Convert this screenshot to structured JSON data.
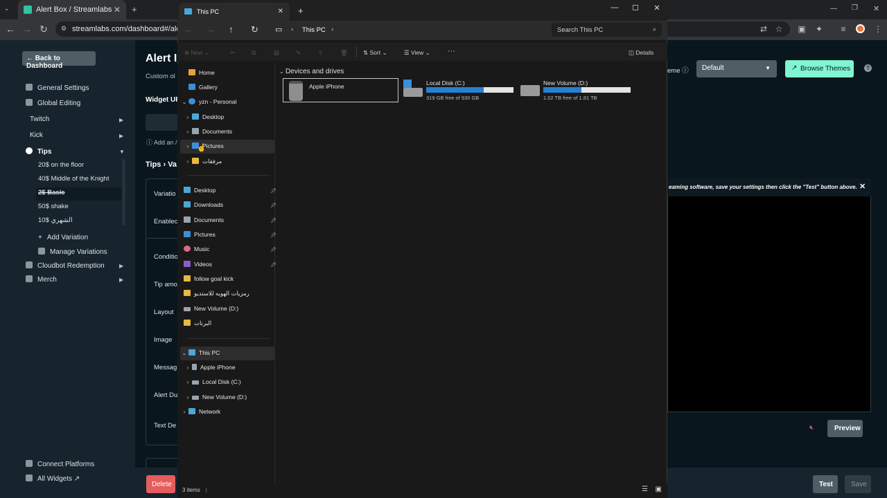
{
  "browser": {
    "tab_title": "Alert Box / Streamlabs",
    "url": "streamlabs.com/dashboard#/alertbc"
  },
  "streamlabs": {
    "back_button": "Back to Dashboard",
    "page_title": "Alert I",
    "page_subtitle": "Custom ol",
    "widget_url_label": "Widget UR",
    "add_note": "Add an /",
    "breadcrumb": "Tips › Va",
    "sidebar": {
      "general_settings": "General Settings",
      "global_editing": "Global Editing",
      "twitch": "Twitch",
      "kick": "Kick",
      "tips": "Tips",
      "tip_variations": [
        "20$ on the floor",
        "40$ Middle of the Knight",
        "2$ Basic",
        "50$ shake",
        "10$ الشهري"
      ],
      "add_variation": "Add Variation",
      "manage_variations": "Manage Variations",
      "cloudbot": "Cloudbot Redemption",
      "merch": "Merch",
      "connect_platforms": "Connect Platforms",
      "all_widgets": "All Widgets"
    },
    "form_labels": [
      "Variatio",
      "Enablec",
      "Conditio",
      "Tip amo",
      "Layout",
      "Image",
      "Messag",
      "Alert Du",
      "Text De"
    ],
    "theme_label": "eme",
    "theme_value": "Default",
    "browse_themes": "Browse Themes",
    "preview_note": "eaming software, save your settings then click the \"Test\" button above.",
    "preview_button": "Preview",
    "delete_button": "Delete",
    "test_button": "Test",
    "save_button": "Save"
  },
  "explorer": {
    "tab_title": "This PC",
    "address": "This PC",
    "search_placeholder": "Search This PC",
    "commands": {
      "new": "New",
      "sort": "Sort",
      "view": "View",
      "more": "···",
      "details": "Details"
    },
    "nav": {
      "home": "Home",
      "gallery": "Gallery",
      "onedrive": "yzn - Personal",
      "od_desktop": "Desktop",
      "od_documents": "Documents",
      "od_pictures": "Pictures",
      "od_attachments": "مرفقات",
      "q_desktop": "Desktop",
      "q_downloads": "Downloads",
      "q_documents": "Documents",
      "q_pictures": "Pictures",
      "q_music": "Music",
      "q_videos": "Videos",
      "q_follow": "follow goal kick",
      "q_arabic1": "رمزيات الهويه للاستديو",
      "q_newvol": "New Volume (D:)",
      "q_arabic2": "البرنات",
      "this_pc": "This PC",
      "pc_iphone": "Apple iPhone",
      "pc_c": "Local Disk (C:)",
      "pc_d": "New Volume (D:)",
      "network": "Network"
    },
    "section_heading": "Devices and drives",
    "devices": [
      {
        "name": "Apple iPhone"
      },
      {
        "name": "Local Disk (C:)",
        "detail": "319 GB free of 930 GB",
        "used_fraction": 0.66
      },
      {
        "name": "New Volume (D:)",
        "detail": "1.02 TB free of 1.81 TB",
        "used_fraction": 0.44
      }
    ],
    "status": "3 items"
  },
  "colors": {
    "accent_teal": "#80f5d2",
    "delete_red": "#e55c5c",
    "drive_blue": "#2580d6"
  }
}
